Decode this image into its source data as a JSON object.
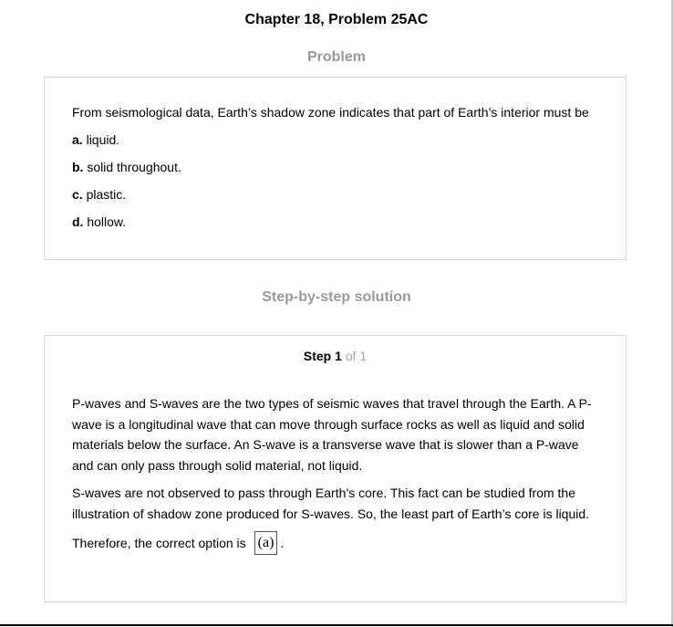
{
  "header": {
    "title": "Chapter 18, Problem 25AC"
  },
  "problem": {
    "heading": "Problem",
    "question": "From seismological data, Earth’s shadow zone indicates that part of Earth’s interior must be",
    "options": [
      {
        "letter": "a.",
        "text": "liquid."
      },
      {
        "letter": "b.",
        "text": "solid throughout."
      },
      {
        "letter": "c.",
        "text": "plastic."
      },
      {
        "letter": "d.",
        "text": "hollow."
      }
    ]
  },
  "solution": {
    "heading": "Step-by-step solution",
    "step_label": "Step 1",
    "step_of": "of 1",
    "paragraphs": [
      "P-waves and S-waves are the two types of seismic waves that travel through the Earth. A P-wave is a longitudinal wave that can move through surface rocks as well as liquid and solid materials below the surface. An S-wave is a transverse wave that is slower than a P-wave and can only pass through solid material, not liquid.",
      "S-waves are not observed to pass through Earth’s core. This fact can be studied from the illustration of shadow zone produced for S-waves. So, the least part of Earth’s core is liquid."
    ],
    "answer_prefix": "Therefore, the correct option is",
    "answer_value": "(a)",
    "answer_suffix": "."
  }
}
